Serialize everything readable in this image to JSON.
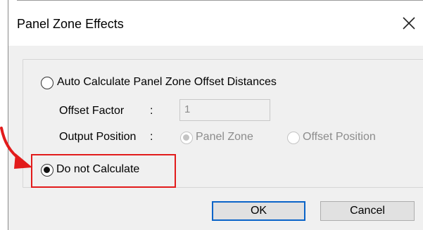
{
  "dialog": {
    "title": "Panel Zone Effects",
    "close_icon": "close-icon"
  },
  "options": {
    "auto_label": "Auto Calculate Panel Zone Offset Distances",
    "auto_selected": false,
    "offset_factor_label": "Offset Factor",
    "offset_factor_colon": ":",
    "offset_factor_value": "1",
    "output_position_label": "Output Position",
    "output_position_colon": ":",
    "panel_zone_label": "Panel Zone",
    "panel_zone_selected": true,
    "offset_position_label": "Offset Position",
    "offset_position_selected": false,
    "do_not_calculate_label": "Do not Calculate",
    "do_not_calculate_selected": true
  },
  "buttons": {
    "ok_label": "OK",
    "cancel_label": "Cancel"
  },
  "colors": {
    "highlight": "#e21b1b",
    "default_button_border": "#0a64c8"
  },
  "annotation": {
    "arrow_icon": "red-curved-arrow-icon"
  }
}
